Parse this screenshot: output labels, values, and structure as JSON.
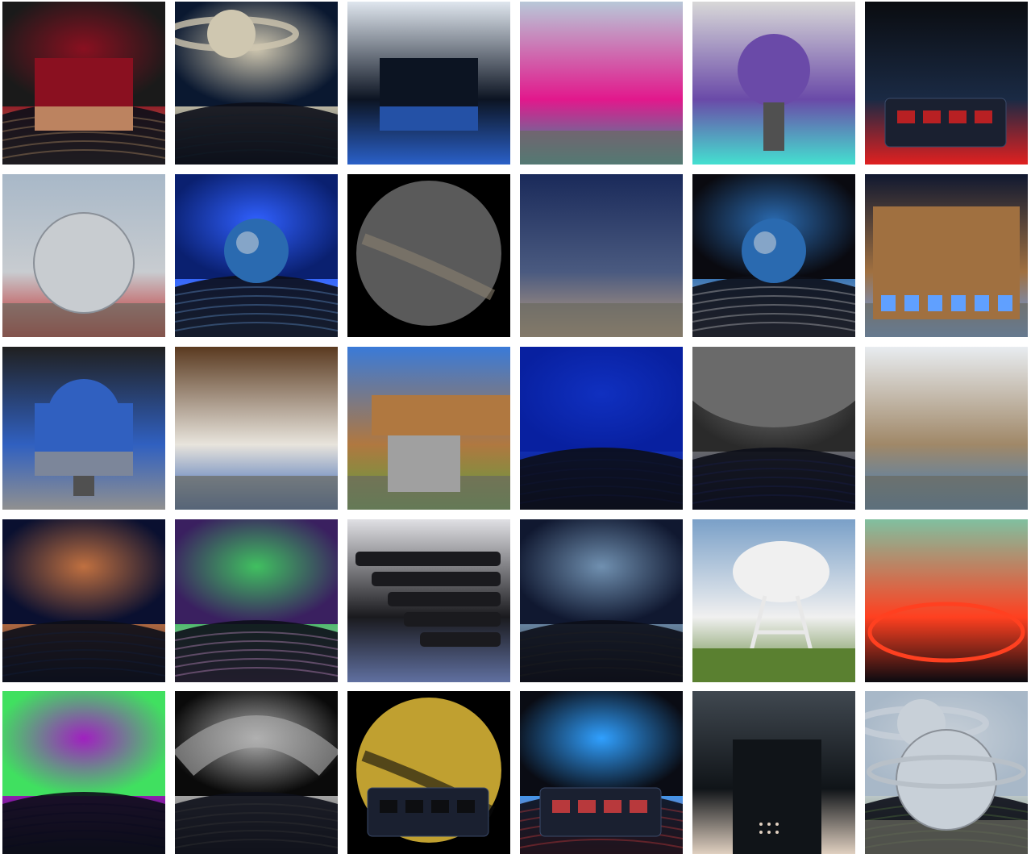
{
  "gallery": {
    "rows": 5,
    "cols": 6,
    "tiles": [
      {
        "scene": "dome-auditorium-red-seats",
        "colors": [
          "#1a1a1a",
          "#8a1020",
          "#c8a070"
        ]
      },
      {
        "scene": "saturn-dome-projection",
        "colors": [
          "#0a1830",
          "#cfc7b0",
          "#10202c"
        ]
      },
      {
        "scene": "theatre-entrance-blue-seats",
        "colors": [
          "#dfe6ee",
          "#0c1422",
          "#2a60c8"
        ]
      },
      {
        "scene": "life-sign-archway",
        "colors": [
          "#b8c8d8",
          "#e2188c",
          "#20a0a0"
        ]
      },
      {
        "scene": "projector-star-ball-installation",
        "colors": [
          "#d8d8d8",
          "#6a4aa8",
          "#44e0d0"
        ]
      },
      {
        "scene": "control-console-buttons",
        "colors": [
          "#0a0c10",
          "#1a2a44",
          "#e02020"
        ]
      },
      {
        "scene": "silver-globe-building",
        "colors": [
          "#a8b8c8",
          "#c8ccd0",
          "#c02020"
        ]
      },
      {
        "scene": "constellations-earth-dome",
        "colors": [
          "#0a2070",
          "#3060ff",
          "#6aa0e0"
        ]
      },
      {
        "scene": "fisheye-milky-way",
        "colors": [
          "#000000",
          "#5a5a5a",
          "#8a8070"
        ]
      },
      {
        "scene": "building-twilight-sky",
        "colors": [
          "#1a2a5a",
          "#4a5a80",
          "#c0a080"
        ]
      },
      {
        "scene": "space-telescope-earth-dome",
        "colors": [
          "#0a0a10",
          "#2a6ab0",
          "#d8d8d8"
        ]
      },
      {
        "scene": "historic-building-night",
        "colors": [
          "#101830",
          "#a07040",
          "#60a0ff"
        ]
      },
      {
        "scene": "zeiss-projector-blue-hall",
        "colors": [
          "#202020",
          "#3060c0",
          "#909090"
        ]
      },
      {
        "scene": "digital-planetarium-lobby",
        "colors": [
          "#5a3a20",
          "#e8e4dc",
          "#2a5ab0"
        ]
      },
      {
        "scene": "cantilever-copper-building",
        "colors": [
          "#3a7ad8",
          "#b07840",
          "#5aa040"
        ]
      },
      {
        "scene": "blue-dome-seating",
        "colors": [
          "#0820a0",
          "#1030c0",
          "#101838"
        ]
      },
      {
        "scene": "moon-dome-seating",
        "colors": [
          "#2a2a2a",
          "#707070",
          "#1a2050"
        ]
      },
      {
        "scene": "modern-curved-facade",
        "colors": [
          "#e8ecf0",
          "#a08868",
          "#4080c0"
        ]
      },
      {
        "scene": "nebula-dome-projection",
        "colors": [
          "#0a1030",
          "#c07040",
          "#102040"
        ]
      },
      {
        "scene": "glowing-dome-reflection",
        "colors": [
          "#3a2060",
          "#40c060",
          "#e0a0e0"
        ]
      },
      {
        "scene": "reclining-seats-rows",
        "colors": [
          "#e0e0e4",
          "#1a1a1e",
          "#6070a0"
        ]
      },
      {
        "scene": "milky-way-dome-seats",
        "colors": [
          "#101830",
          "#7090b0",
          "#202020"
        ]
      },
      {
        "scene": "radio-telescope-dish",
        "colors": [
          "#7aa0c8",
          "#f0f0f0",
          "#5a8030"
        ]
      },
      {
        "scene": "red-ring-star-floor",
        "colors": [
          "#80c0a0",
          "#ff4020",
          "#0a0a10"
        ]
      },
      {
        "scene": "aurora-dome",
        "colors": [
          "#40e060",
          "#a020c0",
          "#0a0a20"
        ]
      },
      {
        "scene": "hexagon-pattern-dome",
        "colors": [
          "#0a0a0a",
          "#b0b0b0",
          "#3a3a3a"
        ]
      },
      {
        "scene": "tree-fisheye-dome-console",
        "colors": [
          "#3a6ad0",
          "#c0a030",
          "#0a0a0a"
        ]
      },
      {
        "scene": "particle-lines-console",
        "colors": [
          "#0a0c14",
          "#30a0ff",
          "#e04040"
        ]
      },
      {
        "scene": "silhouette-night-sky",
        "colors": [
          "#404850",
          "#101418",
          "#e0d0c0"
        ]
      },
      {
        "scene": "saturn-ring-mirror-building",
        "colors": [
          "#a8b8c8",
          "#c8d0d8",
          "#5a7a40"
        ]
      }
    ]
  }
}
